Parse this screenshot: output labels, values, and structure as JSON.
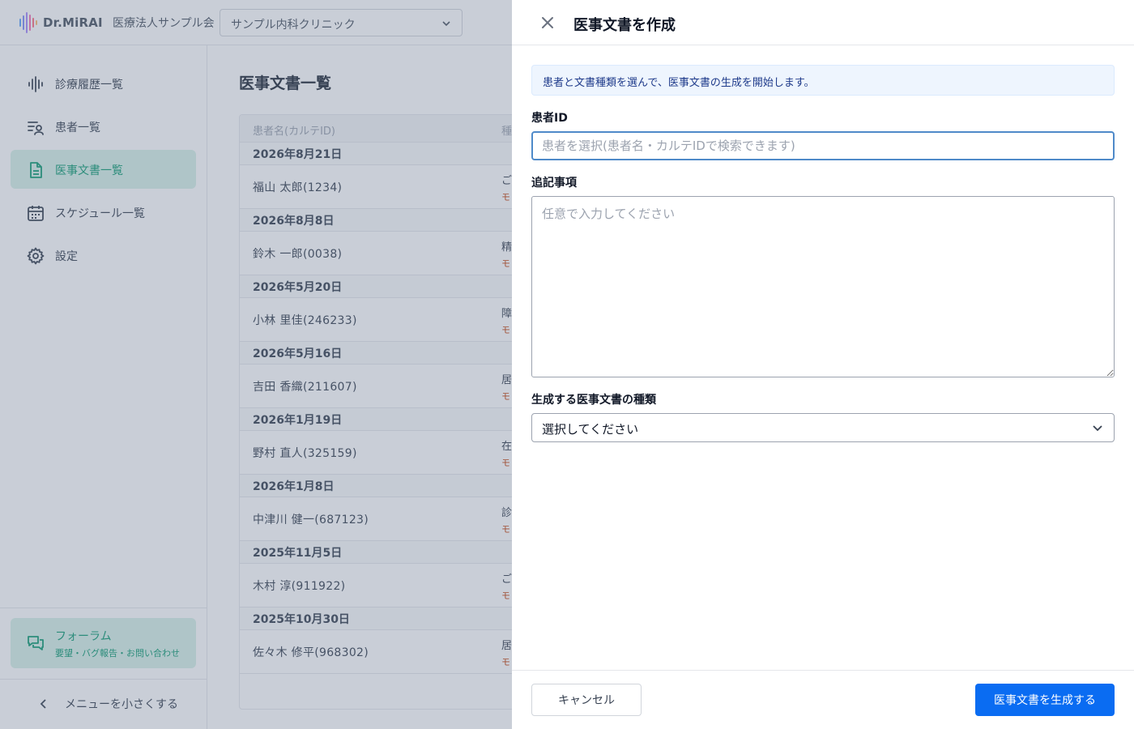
{
  "header": {
    "brand": "Dr.MiRAI",
    "org_name": "医療法人サンプル会",
    "clinic_select": {
      "value": "サンプル内科クリニック"
    }
  },
  "sidebar": {
    "items": [
      {
        "label": "診療履歴一覧",
        "icon": "waveform-icon",
        "active": false
      },
      {
        "label": "患者一覧",
        "icon": "patient-list-icon",
        "active": false
      },
      {
        "label": "医事文書一覧",
        "icon": "document-icon",
        "active": true
      },
      {
        "label": "スケジュール一覧",
        "icon": "calendar-icon",
        "active": false
      },
      {
        "label": "設定",
        "icon": "gear-icon",
        "active": false
      }
    ],
    "forum": {
      "title": "フォーラム",
      "subtitle": "要望・バグ報告・お問い合わせ"
    },
    "collapse_label": "メニューを小さくする"
  },
  "main": {
    "page_title": "医事文書一覧",
    "table": {
      "columns": [
        "患者名(カルテID)",
        "種"
      ],
      "groups": [
        {
          "date": "2026年8月21日",
          "patient": "福山 太郎(1234)",
          "type": "ご",
          "model": "モ"
        },
        {
          "date": "2026年8月8日",
          "patient": "鈴木 一郎(0038)",
          "type": "精",
          "model": "モ"
        },
        {
          "date": "2026年5月20日",
          "patient": "小林 里佳(246233)",
          "type": "障",
          "model": "モ"
        },
        {
          "date": "2026年5月16日",
          "patient": "吉田 香織(211607)",
          "type": "居",
          "model": "モ"
        },
        {
          "date": "2026年1月19日",
          "patient": "野村 直人(325159)",
          "type": "在",
          "model": "モ"
        },
        {
          "date": "2026年1月8日",
          "patient": "中津川 健一(687123)",
          "type": "診",
          "model": "モ"
        },
        {
          "date": "2025年11月5日",
          "patient": "木村 淳(911922)",
          "type": "ご",
          "model": "モ"
        },
        {
          "date": "2025年10月30日",
          "patient": "佐々木 修平(968302)",
          "type": "居",
          "model": "モ"
        }
      ]
    }
  },
  "drawer": {
    "title": "医事文書を作成",
    "info": "患者と文書種類を選んで、医事文書の生成を開始します。",
    "patient_label": "患者ID",
    "patient_placeholder": "患者を選択(患者名・カルテIDで検索できます)",
    "patient_value": "",
    "notes_label": "追記事項",
    "notes_placeholder": "任意で入力してください",
    "notes_value": "",
    "type_label": "生成する医事文書の種類",
    "type_value": "選択してください",
    "cancel_label": "キャンセル",
    "generate_label": "医事文書を生成する"
  },
  "colors": {
    "accent_green": "#0f9b72",
    "active_bg": "#d7f1e8",
    "primary_blue": "#0a6cf2",
    "info_bg": "#eef5fe",
    "focus_border": "#4f8ac9",
    "overlay": "rgba(100,116,139,0.35)"
  }
}
